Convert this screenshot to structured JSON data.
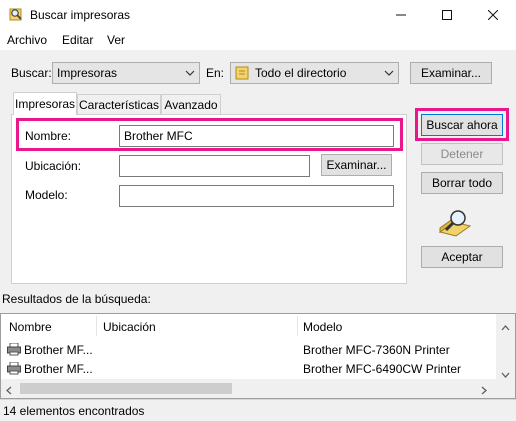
{
  "window": {
    "title": "Buscar impresoras",
    "minimize_glyph": "—",
    "maximize_glyph": "☐",
    "close_glyph": "✕"
  },
  "menu": [
    "Archivo",
    "Editar",
    "Ver"
  ],
  "search": {
    "buscar_label": "Buscar:",
    "buscar_value": "Impresoras",
    "en_label": "En:",
    "en_value": "Todo el directorio",
    "examinar_label": "Examinar..."
  },
  "tabs": [
    "Impresoras",
    "Características",
    "Avanzado"
  ],
  "form": {
    "nombre_label": "Nombre:",
    "nombre_value": "Brother MFC",
    "ubicacion_label": "Ubicación:",
    "ubicacion_value": "",
    "ubicacion_button": "Examinar...",
    "modelo_label": "Modelo:",
    "modelo_value": ""
  },
  "actions": {
    "buscar_ahora": "Buscar ahora",
    "detener": "Detener",
    "borrar_todo": "Borrar todo",
    "aceptar": "Aceptar"
  },
  "results": {
    "label": "Resultados de la búsqueda:",
    "columns": [
      "Nombre",
      "Ubicación",
      "Modelo"
    ],
    "rows": [
      {
        "name": "Brother MF...",
        "location": "",
        "model": "Brother MFC-7360N Printer"
      },
      {
        "name": "Brother MF...",
        "location": "",
        "model": "Brother MFC-6490CW Printer"
      }
    ]
  },
  "status": "14 elementos encontrados",
  "colors": {
    "highlight": "#e8188c",
    "focus_border": "#0078d7"
  },
  "icons": {
    "app": "printer-search-icon",
    "search_anim": "magnifier-search-icon",
    "row": "printer-icon"
  }
}
